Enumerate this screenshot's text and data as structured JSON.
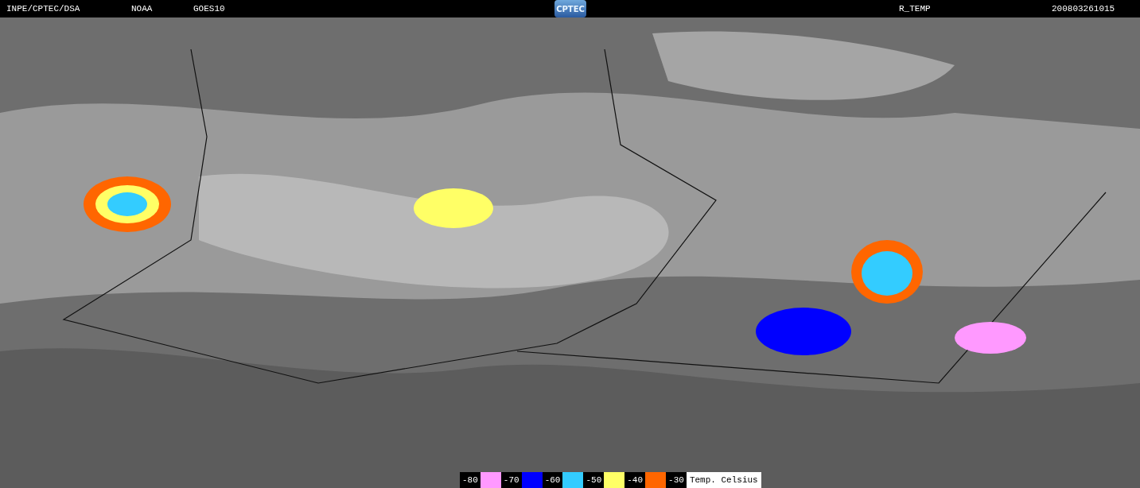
{
  "header": {
    "source": "INPE/CPTEC/DSA",
    "agency": "NOAA",
    "satellite": "GOES10",
    "logo": "CPTEC",
    "product": "R_TEMP",
    "timestamp": "200803261015"
  },
  "legend": {
    "items": [
      {
        "label": "-80",
        "color": "#ff99ff"
      },
      {
        "label": "-70",
        "color": "#0000ff"
      },
      {
        "label": "-60",
        "color": "#33ccff"
      },
      {
        "label": "-50",
        "color": "#ffff66"
      },
      {
        "label": "-40",
        "color": "#ff6600"
      },
      {
        "label": "-30"
      }
    ],
    "unit": "Temp. Celsius"
  }
}
